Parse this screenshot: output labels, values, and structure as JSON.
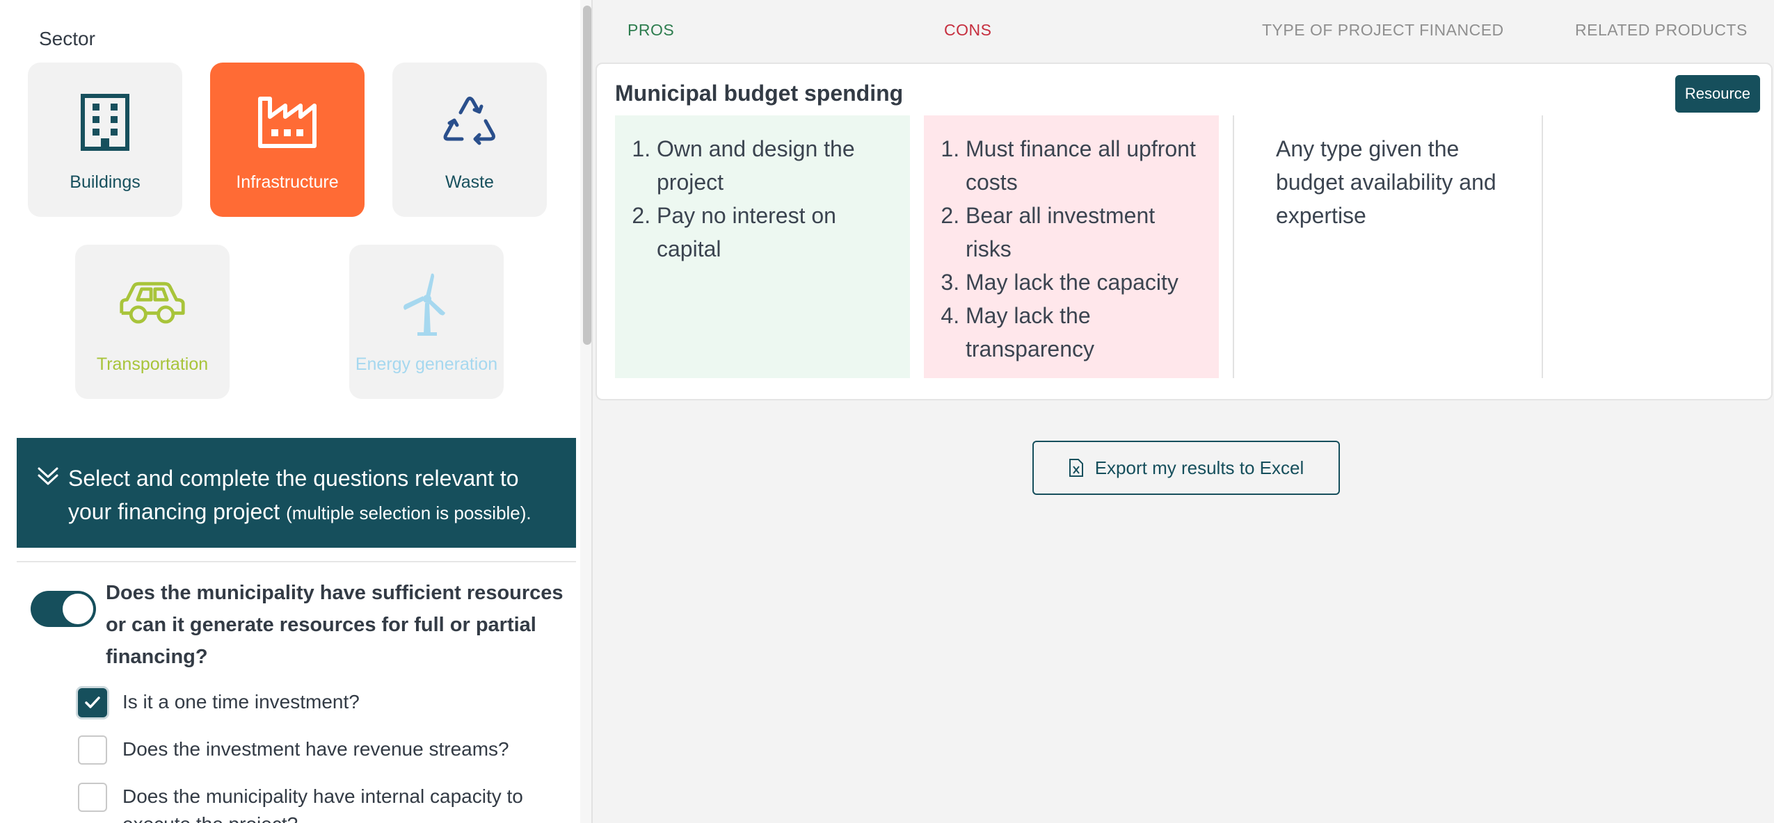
{
  "sector": {
    "title": "Sector",
    "tiles": [
      {
        "label": "Buildings",
        "icon": "building-icon",
        "color": "#17505d",
        "active": false
      },
      {
        "label": "Infrastructure",
        "icon": "factory-icon",
        "color": "#ff6b35",
        "active": true
      },
      {
        "label": "Waste",
        "icon": "recycle-icon",
        "color": "#2a4f8c",
        "active": false
      },
      {
        "label": "Transportation",
        "icon": "car-icon",
        "color": "#a8c43a",
        "active": false
      },
      {
        "label": "Energy generation",
        "icon": "wind-turbine-icon",
        "color": "#a6d8ef",
        "active": false
      }
    ]
  },
  "banner": {
    "main": "Select and complete the questions relevant to your financing project",
    "note": "(multiple selection is possible).",
    "icon": "chevron-double-down-icon"
  },
  "question": {
    "text": "Does the municipality have sufficient resources or can it generate resources for full or partial financing?",
    "toggle_on": true
  },
  "checkboxes": [
    {
      "label": "Is it a one time investment?",
      "checked": true
    },
    {
      "label": "Does the investment have revenue streams?",
      "checked": false
    },
    {
      "label": "Does the municipality have internal capacity to execute the project?",
      "checked": false
    }
  ],
  "columns": {
    "pros": "PROS",
    "cons": "CONS",
    "type": "TYPE OF PROJECT FINANCED",
    "related": "RELATED PRODUCTS"
  },
  "result": {
    "title": "Municipal budget spending",
    "resource_label": "Resource",
    "pros": [
      "Own and design the project",
      "Pay no interest on capital"
    ],
    "cons": [
      "Must finance all upfront costs",
      "Bear all investment risks",
      "May lack the capacity",
      "May lack the transparency"
    ],
    "type": "Any type given the budget availability and expertise",
    "related": ""
  },
  "export": {
    "label": "Export my results to Excel",
    "icon": "excel-file-icon"
  },
  "colors": {
    "primary": "#164f5c",
    "accent": "#ff6b35",
    "pros_bg": "#edf8f1",
    "cons_bg": "#ffe7eb"
  }
}
